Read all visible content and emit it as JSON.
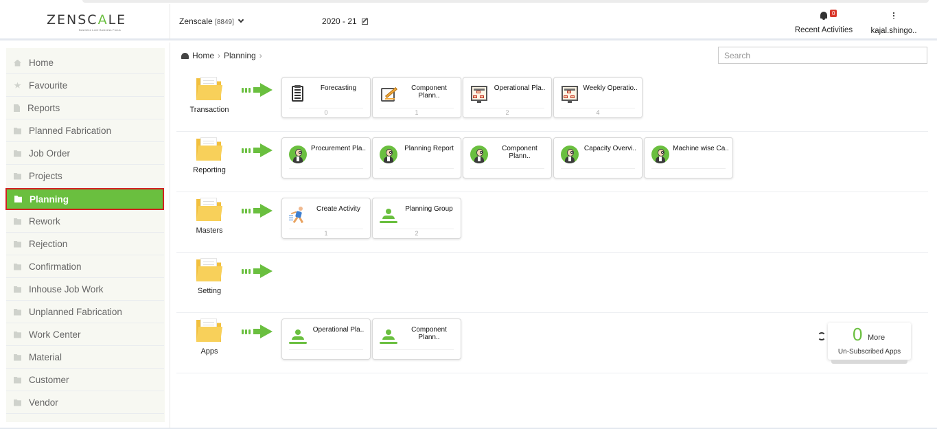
{
  "brand": {
    "logo_left": "ZENSC",
    "logo_mid": "A",
    "logo_right": "LE",
    "tagline": "Business Love Business Focus"
  },
  "header": {
    "company": "Zenscale",
    "company_code": "[8849]",
    "year": "2020 - 21",
    "notifications_count": "0",
    "activities_label": "Recent Activities",
    "user_label": "kajal.shingo.."
  },
  "sidebar": {
    "items": [
      {
        "label": "Home",
        "icon": "home-icon"
      },
      {
        "label": "Favourite",
        "icon": "star-icon"
      },
      {
        "label": "Reports",
        "icon": "document-icon"
      },
      {
        "label": "Planned Fabrication",
        "icon": "folder-icon"
      },
      {
        "label": "Job Order",
        "icon": "folder-icon"
      },
      {
        "label": "Projects",
        "icon": "folder-icon"
      },
      {
        "label": "Planning",
        "icon": "folder-icon",
        "active": true
      },
      {
        "label": "Rework",
        "icon": "folder-icon"
      },
      {
        "label": "Rejection",
        "icon": "folder-icon"
      },
      {
        "label": "Confirmation",
        "icon": "folder-icon"
      },
      {
        "label": "Inhouse Job Work",
        "icon": "folder-icon"
      },
      {
        "label": "Unplanned Fabrication",
        "icon": "folder-icon"
      },
      {
        "label": "Work Center",
        "icon": "folder-icon"
      },
      {
        "label": "Material",
        "icon": "folder-icon"
      },
      {
        "label": "Customer",
        "icon": "folder-icon"
      },
      {
        "label": "Vendor",
        "icon": "folder-icon"
      }
    ]
  },
  "breadcrumb": {
    "home": "Home",
    "current": "Planning"
  },
  "search": {
    "placeholder": "Search",
    "value": ""
  },
  "sections": [
    {
      "label": "Transaction",
      "tiles": [
        {
          "title": "Forecasting",
          "count": "0",
          "icon": "document-icon"
        },
        {
          "title": "Component Plann..",
          "count": "1",
          "icon": "pencil-icon"
        },
        {
          "title": "Operational Pla..",
          "count": "2",
          "icon": "board-icon"
        },
        {
          "title": "Weekly Operatio..",
          "count": "4",
          "icon": "board-icon"
        }
      ]
    },
    {
      "label": "Reporting",
      "tiles": [
        {
          "title": "Procurement Pla..",
          "count": "",
          "icon": "report-face-icon"
        },
        {
          "title": "Planning Report",
          "count": "",
          "icon": "report-face-icon"
        },
        {
          "title": "Component Plann..",
          "count": "",
          "icon": "report-face-icon"
        },
        {
          "title": "Capacity Overvi..",
          "count": "",
          "icon": "report-face-icon"
        },
        {
          "title": "Machine wise Ca..",
          "count": "",
          "icon": "report-face-icon"
        }
      ]
    },
    {
      "label": "Masters",
      "tiles": [
        {
          "title": "Create Activity",
          "count": "1",
          "icon": "runner-icon"
        },
        {
          "title": "Planning Group",
          "count": "2",
          "icon": "person-icon"
        }
      ]
    },
    {
      "label": "Setting",
      "tiles": []
    },
    {
      "label": "Apps",
      "tiles": [
        {
          "title": "Operational Pla..",
          "count": "",
          "icon": "person-icon"
        },
        {
          "title": "Component Plann..",
          "count": "",
          "icon": "person-icon"
        }
      ]
    }
  ],
  "more_apps": {
    "count": "0",
    "more_label": "More",
    "subtitle": "Un-Subscribed Apps"
  },
  "colors": {
    "accent": "#6abf3f",
    "active_border": "#d32020",
    "folder": "#f2c03e",
    "badge": "#d9372b"
  }
}
